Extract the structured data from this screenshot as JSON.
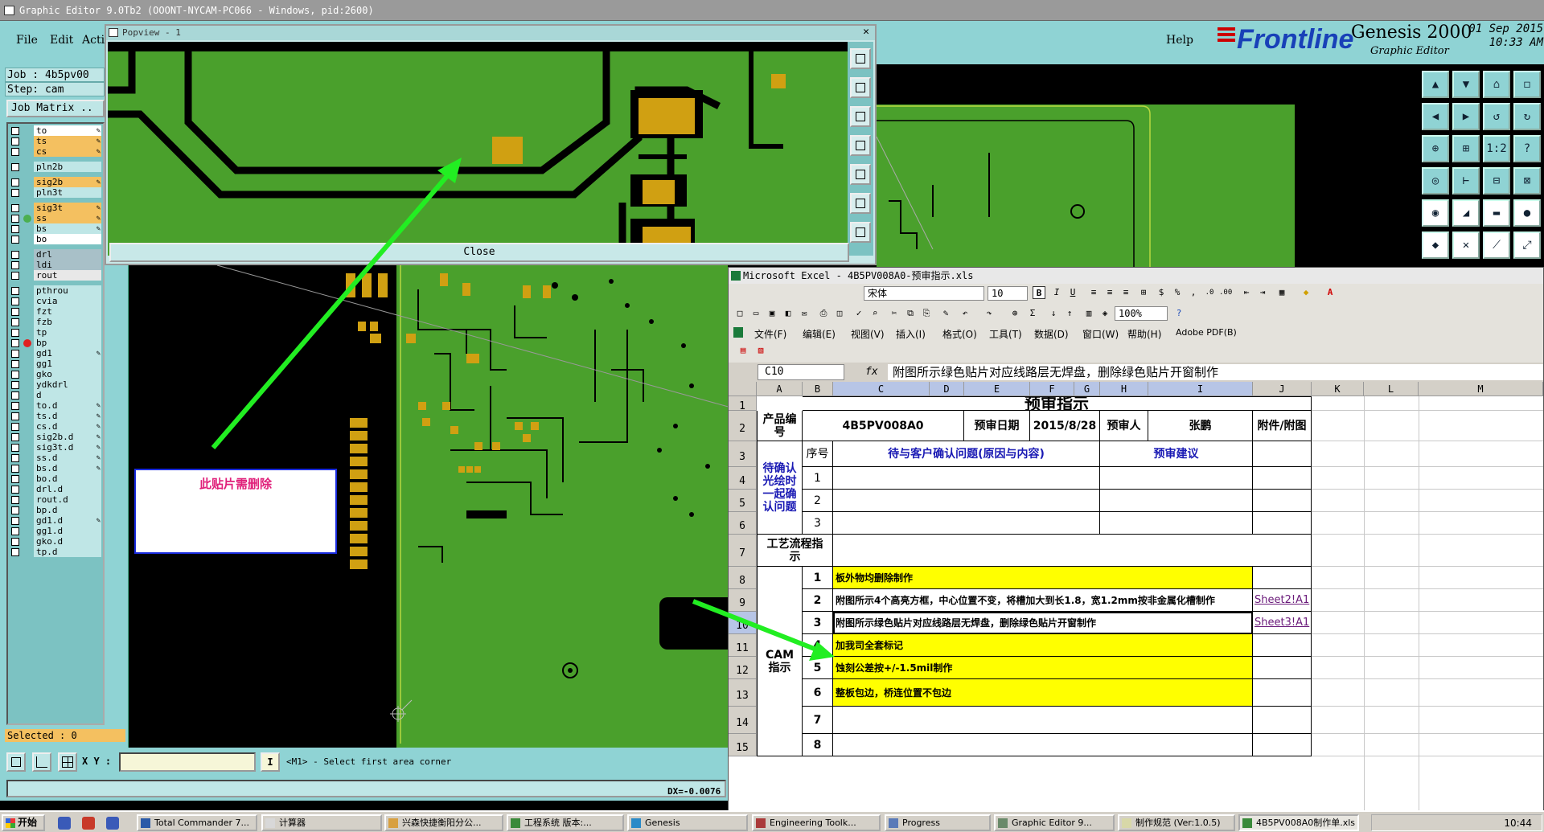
{
  "genesis": {
    "title": "Graphic Editor 9.0Tb2 (OOONT-NYCAM-PC066 - Windows, pid:2600)",
    "menu": [
      "File",
      "Edit",
      "Acti"
    ],
    "help_label": "Help",
    "logo": {
      "brand": "Frontline",
      "product": "Genesis 2000",
      "subtitle": "Graphic Editor",
      "date": "01 Sep 2015",
      "time": "10:33 AM"
    },
    "job_label": "Job : 4b5pv00",
    "step_label": "Step: cam",
    "job_matrix_label": "Job Matrix ..",
    "layers": [
      {
        "name": "to",
        "color": "#ffffff",
        "pen": true
      },
      {
        "name": "ts",
        "color": "#f4c060",
        "pen": true
      },
      {
        "name": "cs",
        "color": "#f4c060",
        "pen": true
      },
      {
        "name": "pln2b",
        "color": "#bfe6e6",
        "pen": false
      },
      {
        "name": "sig2b",
        "color": "#f4c060",
        "pen": true
      },
      {
        "name": "pln3t",
        "color": "#bfe6e6",
        "pen": false
      },
      {
        "name": "sig3t",
        "color": "#f4c060",
        "pen": true
      },
      {
        "name": "ss",
        "color": "#f4c060",
        "pen": true,
        "dot": "#4caf50"
      },
      {
        "name": "bs",
        "color": "#bfe6e6",
        "pen": true
      },
      {
        "name": "bo",
        "color": "#ffffff",
        "pen": false
      },
      {
        "name": "drl",
        "color": "#a8c0c8",
        "pen": false
      },
      {
        "name": "ldi",
        "color": "#a8c0c8",
        "pen": false
      },
      {
        "name": "rout",
        "color": "#e8e8e8",
        "pen": false
      },
      {
        "name": "pthrou",
        "color": "#bfe6e6",
        "pen": false
      },
      {
        "name": "cvia",
        "color": "#bfe6e6",
        "pen": false
      },
      {
        "name": "fzt",
        "color": "#bfe6e6",
        "pen": false
      },
      {
        "name": "fzb",
        "color": "#bfe6e6",
        "pen": false
      },
      {
        "name": "tp",
        "color": "#bfe6e6",
        "pen": false
      },
      {
        "name": "bp",
        "color": "#bfe6e6",
        "pen": false,
        "dot": "#e02020"
      },
      {
        "name": "gd1",
        "color": "#bfe6e6",
        "pen": true
      },
      {
        "name": "gg1",
        "color": "#bfe6e6",
        "pen": false
      },
      {
        "name": "gko",
        "color": "#bfe6e6",
        "pen": false
      },
      {
        "name": "ydkdrl",
        "color": "#bfe6e6",
        "pen": false
      },
      {
        "name": "d",
        "color": "#bfe6e6",
        "pen": false
      },
      {
        "name": "to.d",
        "color": "#bfe6e6",
        "pen": true
      },
      {
        "name": "ts.d",
        "color": "#bfe6e6",
        "pen": true
      },
      {
        "name": "cs.d",
        "color": "#bfe6e6",
        "pen": true
      },
      {
        "name": "sig2b.d",
        "color": "#bfe6e6",
        "pen": true
      },
      {
        "name": "sig3t.d",
        "color": "#bfe6e6",
        "pen": true
      },
      {
        "name": "ss.d",
        "color": "#bfe6e6",
        "pen": true
      },
      {
        "name": "bs.d",
        "color": "#bfe6e6",
        "pen": true
      },
      {
        "name": "bo.d",
        "color": "#bfe6e6",
        "pen": false
      },
      {
        "name": "drl.d",
        "color": "#bfe6e6",
        "pen": false
      },
      {
        "name": "rout.d",
        "color": "#bfe6e6",
        "pen": false
      },
      {
        "name": "bp.d",
        "color": "#bfe6e6",
        "pen": false
      },
      {
        "name": "gd1.d",
        "color": "#bfe6e6",
        "pen": true
      },
      {
        "name": "gg1.d",
        "color": "#bfe6e6",
        "pen": false
      },
      {
        "name": "gko.d",
        "color": "#bfe6e6",
        "pen": false
      },
      {
        "name": "tp.d",
        "color": "#bfe6e6",
        "pen": false
      }
    ],
    "selected_label": "Selected : 0",
    "xy_label": "X Y :",
    "prompt": "<M1> - Select first area corner",
    "dx_readout": "DX=-0.0076"
  },
  "popview": {
    "title": "Popview - 1",
    "close_label": "Close"
  },
  "annotation": {
    "text": "此贴片需删除"
  },
  "excel": {
    "title": "Microsoft Excel - 4B5PV008A0-预审指示.xls",
    "font_name": "宋体",
    "font_size": "10",
    "zoom": "100%",
    "menu": [
      "文件(F)",
      "编辑(E)",
      "视图(V)",
      "插入(I)",
      "格式(O)",
      "工具(T)",
      "数据(D)",
      "窗口(W)",
      "帮助(H)",
      "Adobe PDF(B)"
    ],
    "name_box": "C10",
    "fx": "fx",
    "formula": "附图所示绿色贴片对应线路层无焊盘，删除绿色贴片开窗制作",
    "columns": [
      "A",
      "B",
      "C",
      "D",
      "E",
      "F",
      "G",
      "H",
      "I",
      "J",
      "K",
      "L",
      "M"
    ],
    "rows": [
      "1",
      "2",
      "3",
      "4",
      "5",
      "6",
      "7",
      "8",
      "9",
      "10",
      "11",
      "12",
      "13",
      "14",
      "15"
    ],
    "sheet": {
      "title": "预审指示",
      "product_label": "产品编号",
      "product": "4B5PV008A0",
      "date_label": "预审日期",
      "date": "2015/8/28",
      "reviewer_label": "预审人",
      "reviewer": "张鹏",
      "attachment_label": "附件/附图",
      "seq_label": "序号",
      "confirm_header": "待与客户确认问题(原因与内容)",
      "suggest_header": "预审建议",
      "pending_label": "待确认光绘时一起确认问题",
      "nums_a": [
        "1",
        "2",
        "3"
      ],
      "process_label": "工艺流程指示",
      "cam_label": "CAM指示",
      "cam_items": [
        {
          "n": "1",
          "text": "板外物均删除制作",
          "link": "",
          "yellow": true
        },
        {
          "n": "2",
          "text": "附图所示4个高亮方框，中心位置不变，将槽加大到长1.8，宽1.2mm按非金属化槽制作",
          "link": "Sheet2!A1",
          "yellow": false
        },
        {
          "n": "3",
          "text": "附图所示绿色贴片对应线路层无焊盘，删除绿色贴片开窗制作",
          "link": "Sheet3!A1",
          "yellow": false
        },
        {
          "n": "4",
          "text": "加我司全套标记",
          "link": "",
          "yellow": true
        },
        {
          "n": "5",
          "text": "蚀刻公差按+/-1.5mil制作",
          "link": "",
          "yellow": true
        },
        {
          "n": "6",
          "text": "整板包边，桥连位置不包边",
          "link": "",
          "yellow": true
        },
        {
          "n": "7",
          "text": "",
          "link": "",
          "yellow": false
        },
        {
          "n": "8",
          "text": "",
          "link": "",
          "yellow": false
        }
      ]
    }
  },
  "taskbar": {
    "start": "开始",
    "tasks": [
      "Total Commander 7...",
      "计算器",
      "兴森快捷衡阳分公...",
      "工程系统  版本:...",
      "Genesis",
      "Engineering Toolk...",
      "Progress",
      "Graphic Editor 9...",
      "制作规范 (Ver:1.0.5)",
      "4B5PV008A0制作单.xls"
    ],
    "clock": "10:44"
  },
  "colors": {
    "board_green": "#4aa02c",
    "copper": "#d0a012",
    "teal_panel": "#8fd3d4",
    "arrow": "#22ee22"
  }
}
